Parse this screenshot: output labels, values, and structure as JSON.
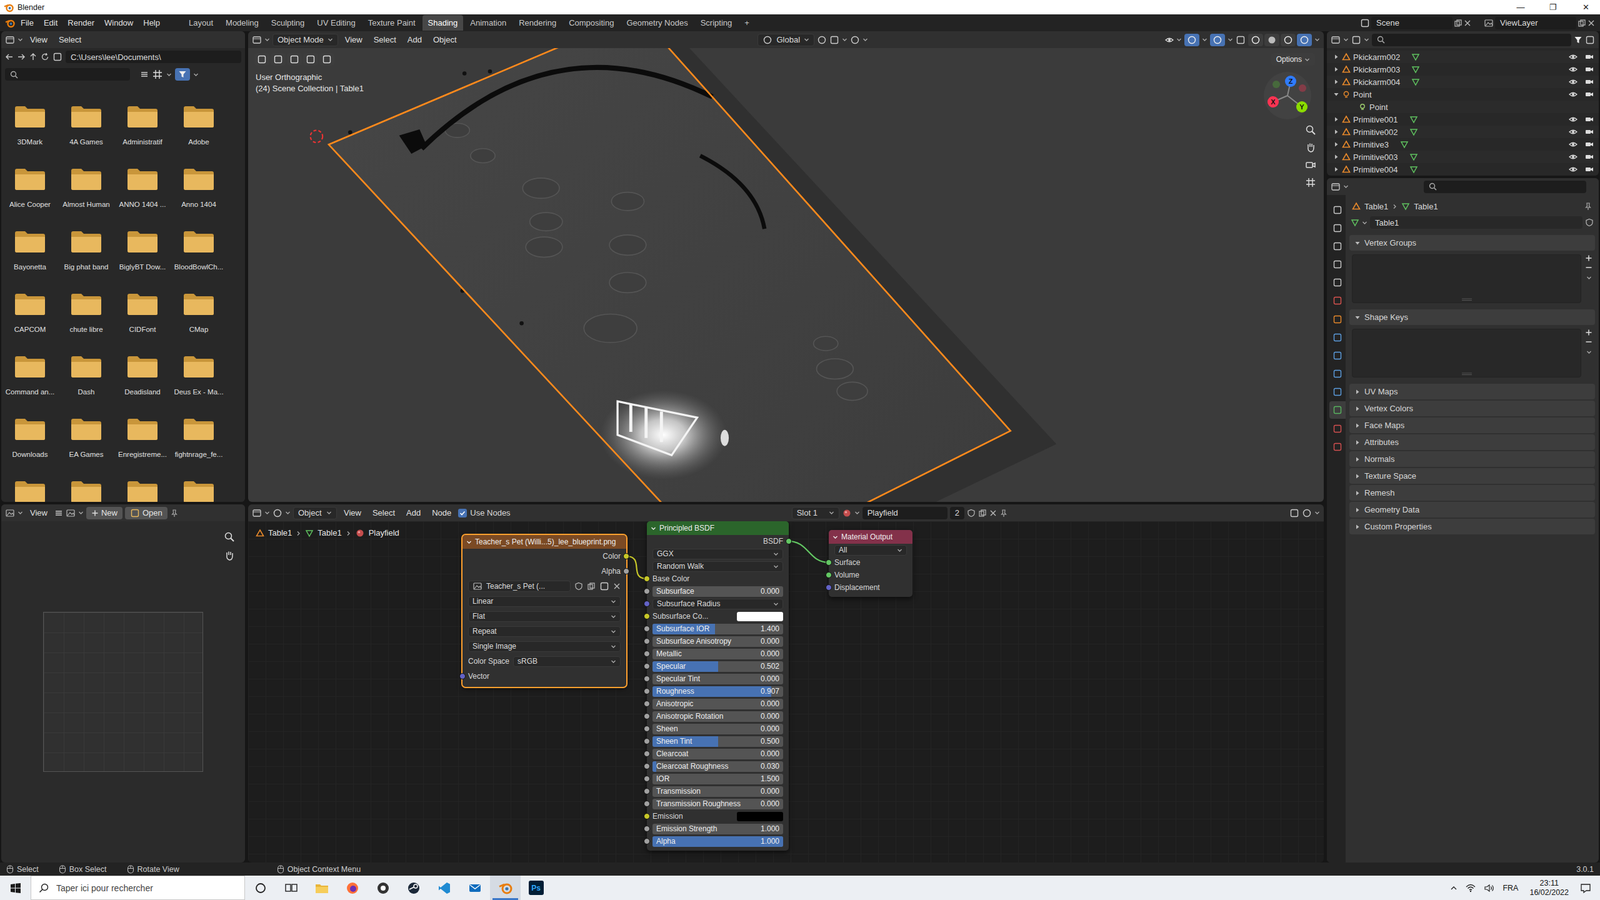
{
  "window": {
    "title": "Blender",
    "controls": [
      "—",
      "❐",
      "✕"
    ]
  },
  "menubar": {
    "menus": [
      "File",
      "Edit",
      "Render",
      "Window",
      "Help"
    ],
    "workspaces": [
      {
        "label": "Layout",
        "selected": false
      },
      {
        "label": "Modeling",
        "selected": false
      },
      {
        "label": "Sculpting",
        "selected": false
      },
      {
        "label": "UV Editing",
        "selected": false
      },
      {
        "label": "Texture Paint",
        "selected": false
      },
      {
        "label": "Shading",
        "selected": true
      },
      {
        "label": "Animation",
        "selected": false
      },
      {
        "label": "Rendering",
        "selected": false
      },
      {
        "label": "Compositing",
        "selected": false
      },
      {
        "label": "Geometry Nodes",
        "selected": false
      },
      {
        "label": "Scripting",
        "selected": false
      }
    ],
    "add_workspace": "+",
    "scene": "Scene",
    "view_layer": "ViewLayer"
  },
  "file_browser": {
    "menus": [
      "View",
      "Select"
    ],
    "path": "C:\\Users\\lee\\Documents\\",
    "folders": [
      {
        "name": "3DMark"
      },
      {
        "name": "4A Games"
      },
      {
        "name": "Administratif"
      },
      {
        "name": "Adobe"
      },
      {
        "name": "Alice Cooper"
      },
      {
        "name": "Almost Human"
      },
      {
        "name": "ANNO 1404 ..."
      },
      {
        "name": "Anno 1404"
      },
      {
        "name": "Bayonetta"
      },
      {
        "name": "Big phat band"
      },
      {
        "name": "BiglyBT Dow..."
      },
      {
        "name": "BloodBowlCh..."
      },
      {
        "name": "CAPCOM"
      },
      {
        "name": "chute libre"
      },
      {
        "name": "CIDFont"
      },
      {
        "name": "CMap"
      },
      {
        "name": "Command an..."
      },
      {
        "name": "Dash"
      },
      {
        "name": "Deadisland"
      },
      {
        "name": "Deus Ex - Ma..."
      },
      {
        "name": "Downloads"
      },
      {
        "name": "EA Games"
      },
      {
        "name": "Enregistreme..."
      },
      {
        "name": "fightnrage_fe..."
      },
      {
        "name": ""
      },
      {
        "name": ""
      },
      {
        "name": ""
      },
      {
        "name": ""
      }
    ]
  },
  "image_editor": {
    "menus": [
      "View"
    ],
    "new": "New",
    "open": "Open"
  },
  "viewport": {
    "mode": "Object Mode",
    "menus": [
      "View",
      "Select",
      "Add",
      "Object"
    ],
    "orientation": "Global",
    "options": "Options",
    "view_name": "User Orthographic",
    "collection": "(24) Scene Collection | Table1",
    "toggles": [
      {
        "selected": true
      },
      {
        "selected": true
      }
    ],
    "shading": [
      {
        "selected": false
      },
      {
        "selected": false
      },
      {
        "selected": false
      },
      {
        "selected": true
      }
    ],
    "axes": [
      {
        "label": "Z",
        "color": "#2f7bff"
      },
      {
        "label": "X",
        "color": "#ff3352"
      },
      {
        "label": "Y",
        "color": "#8bdc00"
      }
    ]
  },
  "node_editor": {
    "mode": "Object",
    "menus": [
      "View",
      "Select",
      "Add",
      "Node"
    ],
    "use_nodes": {
      "label": "Use Nodes",
      "checked": true
    },
    "slot": "Slot 1",
    "material": "Playfield",
    "users": "2",
    "breadcrumb": [
      "Table1",
      "Table1",
      "Playfield"
    ],
    "nodes": {
      "image": {
        "title": "Teacher_s Pet (Willi...5)_lee_blueprint.png",
        "selected": true,
        "outputs": [
          {
            "label": "Color",
            "color": "#c7c729"
          },
          {
            "label": "Alpha",
            "color": "#a1a1a1"
          }
        ],
        "image": "Teacher_s Pet (...",
        "options": [
          "Linear",
          "Flat",
          "Repeat",
          "Single Image"
        ],
        "color_space": {
          "label": "Color Space",
          "value": "sRGB"
        },
        "inputs": [
          {
            "label": "Vector",
            "color": "#6363c7"
          }
        ]
      },
      "bsdf": {
        "title": "Principled BSDF",
        "selected": false,
        "rows": [
          {
            "kind": "output",
            "label": "BSDF",
            "color": "#63c763"
          },
          {
            "kind": "dropdown",
            "label": "GGX"
          },
          {
            "kind": "dropdown",
            "label": "Random Walk"
          },
          {
            "kind": "input",
            "label": "Base Color",
            "color": "#c7c729"
          },
          {
            "kind": "slider",
            "label": "Subsurface",
            "value": "0.000",
            "level": 0,
            "color": "#a1a1a1"
          },
          {
            "kind": "vector",
            "label": "Subsurface Radius",
            "color": "#6363c7"
          },
          {
            "kind": "color",
            "label": "Subsurface Co...",
            "swatch": "#ffffff",
            "color": "#c7c729"
          },
          {
            "kind": "slider",
            "label": "Subsurface IOR",
            "value": "1.400",
            "level": 0.48,
            "color": "#a1a1a1"
          },
          {
            "kind": "slider",
            "label": "Subsurface Anisotropy",
            "value": "0.000",
            "level": 0,
            "color": "#a1a1a1"
          },
          {
            "kind": "slider",
            "label": "Metallic",
            "value": "0.000",
            "level": 0,
            "color": "#a1a1a1"
          },
          {
            "kind": "slider",
            "label": "Specular",
            "value": "0.502",
            "level": 0.502,
            "color": "#a1a1a1"
          },
          {
            "kind": "slider",
            "label": "Specular Tint",
            "value": "0.000",
            "level": 0,
            "color": "#a1a1a1"
          },
          {
            "kind": "slider",
            "label": "Roughness",
            "value": "0.907",
            "level": 0.907,
            "color": "#a1a1a1"
          },
          {
            "kind": "slider",
            "label": "Anisotropic",
            "value": "0.000",
            "level": 0,
            "color": "#a1a1a1"
          },
          {
            "kind": "slider",
            "label": "Anisotropic Rotation",
            "value": "0.000",
            "level": 0,
            "color": "#a1a1a1"
          },
          {
            "kind": "slider",
            "label": "Sheen",
            "value": "0.000",
            "level": 0,
            "color": "#a1a1a1"
          },
          {
            "kind": "slider",
            "label": "Sheen Tint",
            "value": "0.500",
            "level": 0.5,
            "color": "#a1a1a1"
          },
          {
            "kind": "slider",
            "label": "Clearcoat",
            "value": "0.000",
            "level": 0,
            "color": "#a1a1a1"
          },
          {
            "kind": "slider",
            "label": "Clearcoat Roughness",
            "value": "0.030",
            "level": 0.03,
            "color": "#a1a1a1"
          },
          {
            "kind": "slider",
            "label": "IOR",
            "value": "1.500",
            "level": 0,
            "color": "#a1a1a1"
          },
          {
            "kind": "slider",
            "label": "Transmission",
            "value": "0.000",
            "level": 0,
            "color": "#a1a1a1"
          },
          {
            "kind": "slider",
            "label": "Transmission Roughness",
            "value": "0.000",
            "level": 0,
            "color": "#a1a1a1"
          },
          {
            "kind": "color",
            "label": "Emission",
            "swatch": "#000000",
            "color": "#c7c729"
          },
          {
            "kind": "slider",
            "label": "Emission Strength",
            "value": "1.000",
            "level": 0,
            "color": "#a1a1a1"
          },
          {
            "kind": "slider",
            "label": "Alpha",
            "value": "1.000",
            "level": 1,
            "color": "#a1a1a1"
          }
        ]
      },
      "output": {
        "title": "Material Output",
        "selected": false,
        "target": "All",
        "inputs": [
          {
            "label": "Surface",
            "color": "#63c763"
          },
          {
            "label": "Volume",
            "color": "#63c763"
          },
          {
            "label": "Displacement",
            "color": "#6363c7"
          }
        ]
      }
    },
    "links": [
      {
        "from": "image.outputs.0",
        "to": "bsdf.rows.3",
        "color": "#c7c729"
      },
      {
        "from": "bsdf.rows.0",
        "to": "output.inputs.0",
        "color": "#63c763"
      }
    ]
  },
  "outliner": {
    "items": [
      {
        "name": "Pkickarm002",
        "kind": "mesh",
        "expanded": false,
        "visible": true,
        "renderable": true
      },
      {
        "name": "Pkickarm003",
        "kind": "mesh",
        "expanded": false,
        "visible": true,
        "renderable": true
      },
      {
        "name": "Pkickarm004",
        "kind": "mesh",
        "expanded": false,
        "visible": true,
        "renderable": true
      },
      {
        "name": "Point",
        "kind": "light",
        "expanded": true,
        "visible": true,
        "renderable": true
      },
      {
        "name": "Point",
        "kind": "light-data"
      },
      {
        "name": "Primitive001",
        "kind": "mesh",
        "expanded": false,
        "visible": true,
        "renderable": true
      },
      {
        "name": "Primitive002",
        "kind": "mesh",
        "expanded": false,
        "visible": true,
        "renderable": true
      },
      {
        "name": "Primitive3",
        "kind": "mesh",
        "expanded": false,
        "visible": true,
        "renderable": true
      },
      {
        "name": "Primitive003",
        "kind": "mesh",
        "expanded": false,
        "visible": true,
        "renderable": true
      },
      {
        "name": "Primitive004",
        "kind": "mesh",
        "expanded": false,
        "visible": true,
        "renderable": true
      }
    ]
  },
  "properties": {
    "breadcrumb": [
      "Table1",
      "Table1"
    ],
    "name": "Table1",
    "tabs": [
      {
        "color": "#c8c8c8",
        "selected": false
      },
      {
        "color": "#c8c8c8",
        "selected": false
      },
      {
        "color": "#c8c8c8",
        "selected": false
      },
      {
        "color": "#c8c8c8",
        "selected": false
      },
      {
        "color": "#c8c8c8",
        "selected": false
      },
      {
        "color": "#d9534f",
        "selected": false
      },
      {
        "color": "#e8892b",
        "selected": false
      },
      {
        "color": "#5d9ee0",
        "selected": false
      },
      {
        "color": "#5d9ee0",
        "selected": false
      },
      {
        "color": "#5d9ee0",
        "selected": false
      },
      {
        "color": "#5d9ee0",
        "selected": false
      },
      {
        "color": "#59b55f",
        "selected": true
      },
      {
        "color": "#d45050",
        "selected": false
      },
      {
        "color": "#d45050",
        "selected": false
      }
    ],
    "panels": [
      {
        "label": "Vertex Groups",
        "expanded": true
      },
      {
        "label": "Shape Keys",
        "expanded": true
      },
      {
        "label": "UV Maps",
        "expanded": false
      },
      {
        "label": "Vertex Colors",
        "expanded": false
      },
      {
        "label": "Face Maps",
        "expanded": false
      },
      {
        "label": "Attributes",
        "expanded": false
      },
      {
        "label": "Normals",
        "expanded": false
      },
      {
        "label": "Texture Space",
        "expanded": false
      },
      {
        "label": "Remesh",
        "expanded": false
      },
      {
        "label": "Geometry Data",
        "expanded": false
      },
      {
        "label": "Custom Properties",
        "expanded": false
      }
    ]
  },
  "status_bar": {
    "items": [
      "Select",
      "Box Select",
      "Rotate View",
      "Object Context Menu"
    ],
    "version": "3.0.1"
  },
  "taskbar": {
    "search_placeholder": "Taper ici pour rechercher",
    "apps": [
      {
        "kind": "cortana",
        "selected": false
      },
      {
        "kind": "task-view",
        "selected": false
      },
      {
        "kind": "explorer",
        "selected": false
      },
      {
        "kind": "firefox",
        "selected": false
      },
      {
        "kind": "media",
        "selected": false
      },
      {
        "kind": "steam",
        "selected": false
      },
      {
        "kind": "vscode",
        "selected": false
      },
      {
        "kind": "mail",
        "selected": false
      },
      {
        "kind": "blender",
        "selected": true
      },
      {
        "kind": "photoshop",
        "selected": false,
        "label": "Ps"
      }
    ],
    "language": "FRA",
    "time": "23:11",
    "date": "16/02/2022"
  }
}
